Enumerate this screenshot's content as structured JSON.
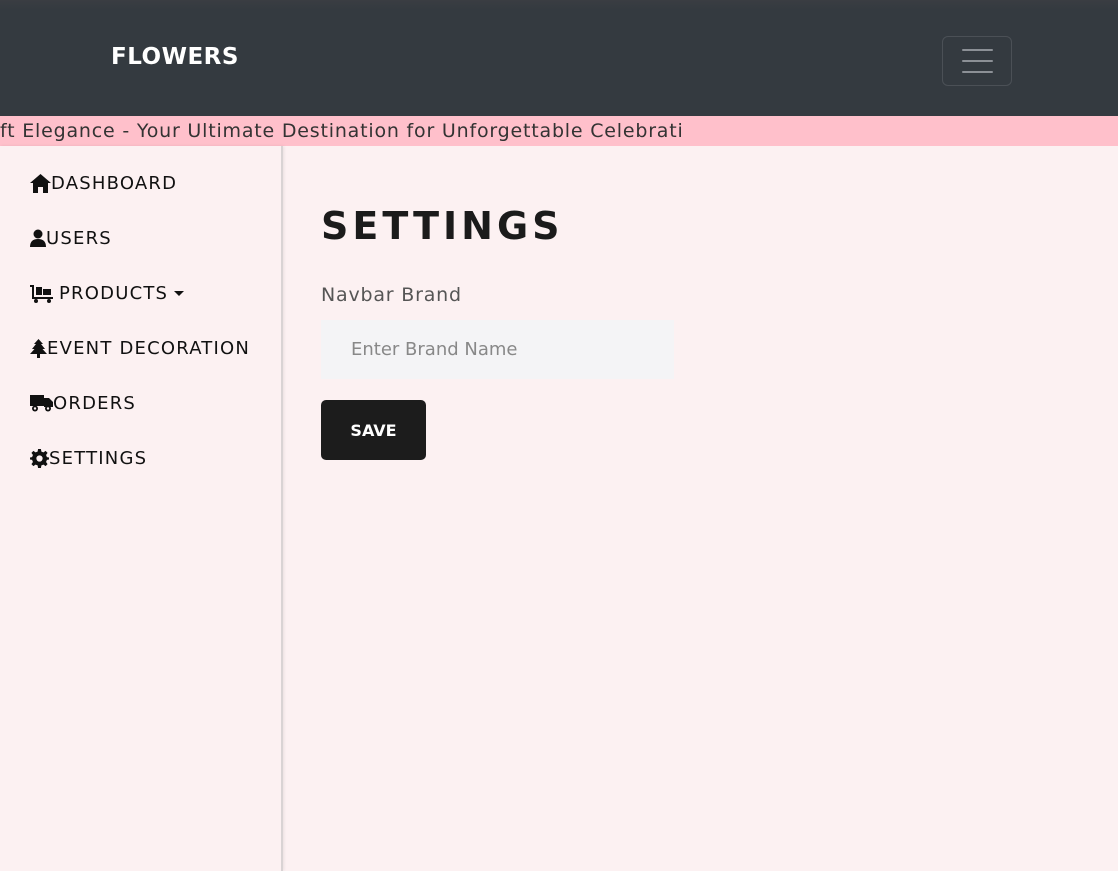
{
  "navbar": {
    "brand": "FLOWERS",
    "toggler_icon": "hamburger-icon"
  },
  "marquee": {
    "text": "ft Elegance - Your Ultimate Destination for Unforgettable Celebrati"
  },
  "sidebar": {
    "items": [
      {
        "label": "DASHBOARD",
        "icon": "home-icon"
      },
      {
        "label": "USERS",
        "icon": "user-icon"
      },
      {
        "label": "PRODUCTS",
        "icon": "dolly-icon"
      },
      {
        "label": "EVENT DECORATION",
        "icon": "tree-icon"
      },
      {
        "label": "ORDERS",
        "icon": "truck-icon"
      },
      {
        "label": "SETTINGS",
        "icon": "gear-icon"
      }
    ]
  },
  "main": {
    "title": "SETTINGS",
    "brand_field_label": "Navbar Brand",
    "brand_field_placeholder": "Enter Brand Name",
    "brand_field_value": "",
    "save_label": "SAVE"
  },
  "colors": {
    "navbar_bg": "#343a40",
    "marquee_bg": "#ffc0cb",
    "page_bg": "#fcf1f2",
    "button_bg": "#1c1c1c"
  }
}
